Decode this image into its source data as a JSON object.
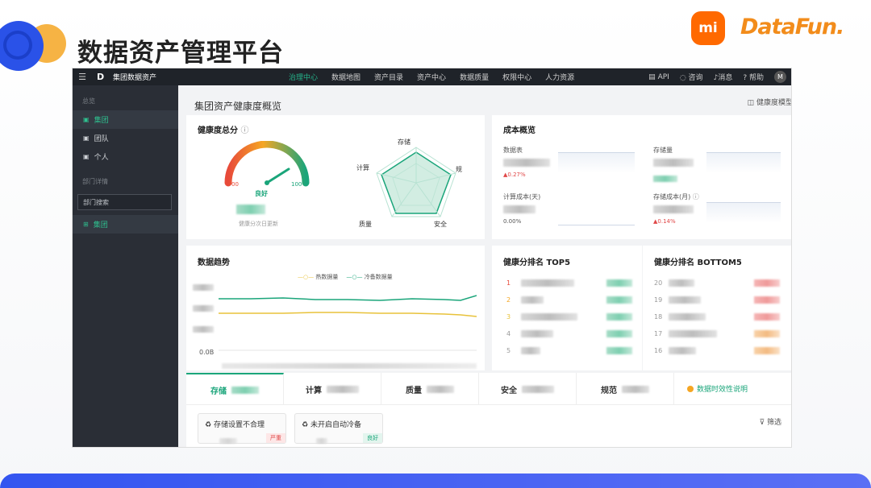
{
  "slide": {
    "title": "数据资产管理平台",
    "brand_mi": "mi",
    "brand_datafun": "DataFun."
  },
  "app": {
    "logo": "D",
    "name": "集团数据资产",
    "nav": [
      "治理中心",
      "数据地图",
      "资产目录",
      "资产中心",
      "数据质量",
      "权限中心",
      "人力资源"
    ],
    "nav_active_index": 0,
    "nav_right": {
      "api": "API",
      "consult": "咨询",
      "messages": "消息",
      "help": "帮助",
      "avatar": "M"
    }
  },
  "sidebar": {
    "group1": "总览",
    "items1": [
      "集团",
      "团队",
      "个人"
    ],
    "active_item": "集团",
    "group2": "部门详情",
    "search_placeholder": "部门搜索",
    "items2": [
      "集团"
    ]
  },
  "page": {
    "heading": "集团资产健康度概览",
    "link": "健康度模型"
  },
  "health": {
    "title": "健康度总分",
    "gauge_min": "00",
    "gauge_max": "100",
    "gauge_label": "良好",
    "gauge_value_fraction": 0.82,
    "update_note": "健康分次日更新",
    "radar_labels": {
      "top": "存储",
      "left": "计算",
      "right": "规",
      "bottom_left": "质量",
      "bottom_right": "安全"
    }
  },
  "cost": {
    "title": "成本概览",
    "metrics": [
      {
        "label": "数据表",
        "change": "0.27%",
        "direction": "up"
      },
      {
        "label": "存储量",
        "change": "",
        "direction": ""
      },
      {
        "label": "计算成本(天)",
        "change": "0.00%",
        "direction": ""
      },
      {
        "label": "存储成本(月)",
        "change": "0.14%",
        "direction": "up"
      }
    ]
  },
  "trend": {
    "title": "数据趋势",
    "legend": [
      {
        "name": "热数据量",
        "color": "#e8c23a"
      },
      {
        "name": "冷备数据量",
        "color": "#1aa57a"
      }
    ],
    "y_min_label": "0.0B"
  },
  "top5": {
    "title": "健康分排名 TOP5",
    "ranks": [
      "1",
      "2",
      "3",
      "4",
      "5"
    ],
    "scores_visible": [
      "",
      "",
      "",
      "",
      ""
    ]
  },
  "bottom5": {
    "title": "健康分排名 BOTTOM5",
    "ranks": [
      "20",
      "19",
      "18",
      "17",
      "16"
    ]
  },
  "tabs": {
    "items": [
      "存储",
      "计算",
      "质量",
      "安全",
      "规范"
    ],
    "active_index": 0,
    "note": "数据时效性说明"
  },
  "issues": [
    {
      "title": "存储设置不合理",
      "tag": "严重",
      "tag_type": "severe"
    },
    {
      "title": "未开启自动冷备",
      "tag": "良好",
      "tag_type": "good"
    }
  ],
  "filter_label": "筛选",
  "colors": {
    "accent": "#1aa57a",
    "nav_bg": "#1f2329",
    "sidebar_bg": "#2a2e36",
    "brand_blue": "#2a52e8",
    "brand_orange": "#ff6900"
  }
}
